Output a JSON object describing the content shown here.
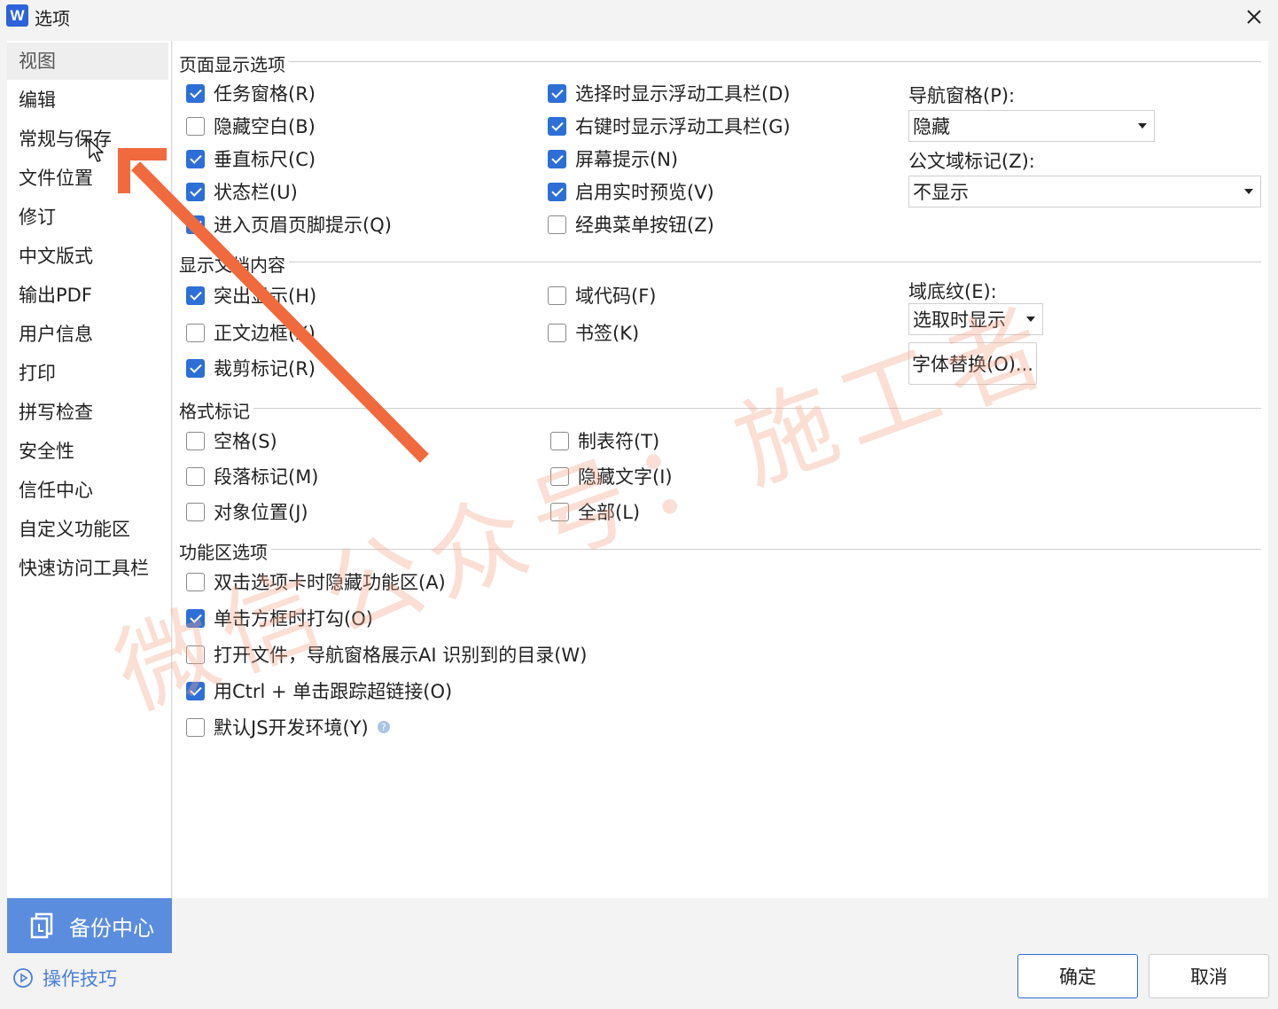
{
  "window": {
    "title": "选项",
    "logo": "W"
  },
  "sidebar": {
    "items": [
      {
        "label": "视图",
        "active": true
      },
      {
        "label": "编辑"
      },
      {
        "label": "常规与保存"
      },
      {
        "label": "文件位置"
      },
      {
        "label": "修订"
      },
      {
        "label": "中文版式"
      },
      {
        "label": "输出PDF"
      },
      {
        "label": "用户信息"
      },
      {
        "label": "打印"
      },
      {
        "label": "拼写检查"
      },
      {
        "label": "安全性"
      },
      {
        "label": "信任中心"
      },
      {
        "label": "自定义功能区"
      },
      {
        "label": "快速访问工具栏"
      }
    ],
    "backup_label": "备份中心",
    "tips_label": "操作技巧"
  },
  "page_display": {
    "title": "页面显示选项",
    "col1": [
      {
        "label": "任务窗格(R)",
        "checked": true
      },
      {
        "label": "隐藏空白(B)",
        "checked": false
      },
      {
        "label": "垂直标尺(C)",
        "checked": true
      },
      {
        "label": "状态栏(U)",
        "checked": true
      },
      {
        "label": "进入页眉页脚提示(Q)",
        "checked": true
      }
    ],
    "col2": [
      {
        "label": "选择时显示浮动工具栏(D)",
        "checked": true
      },
      {
        "label": "右键时显示浮动工具栏(G)",
        "checked": true
      },
      {
        "label": "屏幕提示(N)",
        "checked": true
      },
      {
        "label": "启用实时预览(V)",
        "checked": true
      },
      {
        "label": "经典菜单按钮(Z)",
        "checked": false
      }
    ],
    "nav_pane_label": "导航窗格(P):",
    "nav_pane_value": "隐藏",
    "doc_field_label": "公文域标记(Z):",
    "doc_field_value": "不显示"
  },
  "doc_content": {
    "title": "显示文档内容",
    "col1": [
      {
        "label": "突出显示(H)",
        "checked": true
      },
      {
        "label": "正文边框(X)",
        "checked": false
      },
      {
        "label": "裁剪标记(R)",
        "checked": true
      }
    ],
    "col2": [
      {
        "label": "域代码(F)",
        "checked": false
      },
      {
        "label": "书签(K)",
        "checked": false
      }
    ],
    "field_shading_label": "域底纹(E):",
    "field_shading_value": "选取时显示",
    "font_sub_label": "字体替换(O)..."
  },
  "format_marks": {
    "title": "格式标记",
    "col1": [
      {
        "label": "空格(S)",
        "checked": false
      },
      {
        "label": "段落标记(M)",
        "checked": false
      },
      {
        "label": "对象位置(J)",
        "checked": false
      }
    ],
    "col2": [
      {
        "label": "制表符(T)",
        "checked": false
      },
      {
        "label": "隐藏文字(I)",
        "checked": false
      },
      {
        "label": "全部(L)",
        "checked": false
      }
    ]
  },
  "ribbon": {
    "title": "功能区选项",
    "items": [
      {
        "label": "双击选项卡时隐藏功能区(A)",
        "checked": false
      },
      {
        "label": "单击方框时打勾(O)",
        "checked": true
      },
      {
        "label": "打开文件，导航窗格展示AI 识别到的目录(W)",
        "checked": false
      },
      {
        "label": "用Ctrl + 单击跟踪超链接(O)",
        "checked": true
      },
      {
        "label": "默认JS开发环境(Y)",
        "checked": false
      }
    ]
  },
  "footer": {
    "ok_label": "确定",
    "cancel_label": "取消"
  },
  "watermark_text": "微信公众号：施工者",
  "colors": {
    "accent": "#2d6fd6",
    "backup": "#5b8dde",
    "arrow": "#f06a3e"
  }
}
